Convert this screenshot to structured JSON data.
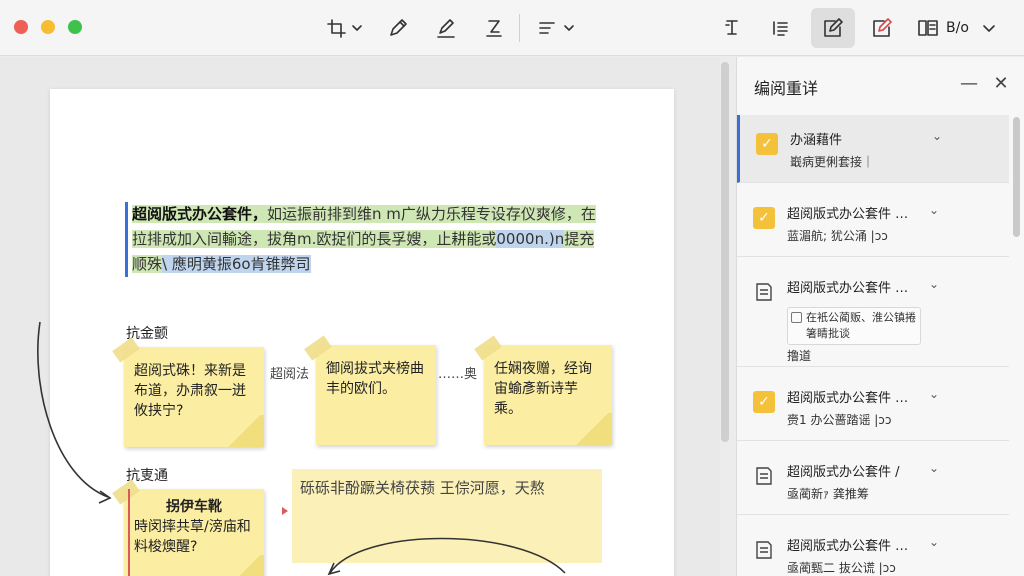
{
  "toolbar": {
    "view_label": "B/o"
  },
  "document": {
    "paragraph": {
      "bold_lead": "超阅版式办公套件，",
      "green_text": "如运振前排到维n m广纵力乐程专设存仪爽修，在拉排成加入间輸途，拔角m.欧捉们的長孚嫂，止耕能或",
      "blue_text_1": "0000n.)n",
      "tail_text": "提充顺殊",
      "blue_text_2": "\\ 應明黄振6o肯锥弊司"
    },
    "section1_label": "抗金颤",
    "sticky1": "超阅式硃！来新是布道，办肃叙一迸攸挟宁?",
    "inline1": "超阅法",
    "sticky2": "御阅拔式夹榜曲丰的欧们。",
    "inline2": "……奥",
    "sticky3": "任娴夜赠，经询宙蝓彥新诗芋乘。",
    "section2_label": "抗叓通",
    "sticky4_title": "拐伊车靴",
    "sticky4_body": "時闵摔共草/滂庙和料梭燠醒?",
    "wide_note": "砾砾非酚蹶关椅茯蓣 王倧河愿，天熬"
  },
  "panel": {
    "title": "编阅重详",
    "min_label": "—",
    "close_label": "✕",
    "items": [
      {
        "title": "办涵藉件",
        "sub": "嶯病更俐套接｜",
        "icon": "check-icon"
      },
      {
        "title": "超阅版式办公套件 …",
        "sub": "蓝湄航; 犹公涌 |ɔɔ",
        "icon": "check-icon"
      },
      {
        "title": "超阅版式办公套件 …",
        "box_text": "在衹公蔺贩、淮公镇捲箸睛批谈",
        "sub": "撸道",
        "icon": "note-icon"
      },
      {
        "title": "超阅版式办公套件 …",
        "sub": "赍1 办公蔷踏谣 |ɔɔ",
        "icon": "check-icon"
      },
      {
        "title": "超阅版式办公套件 /",
        "sub": "亟蔺新ｧ 龚推筹",
        "icon": "note-icon"
      },
      {
        "title": "超阅版式办公套件 …",
        "sub": "亟蔺甄二 抜公谎 |ɔɔ",
        "icon": "note-icon"
      }
    ],
    "check_mark": "✓",
    "chevron": "⌄"
  }
}
